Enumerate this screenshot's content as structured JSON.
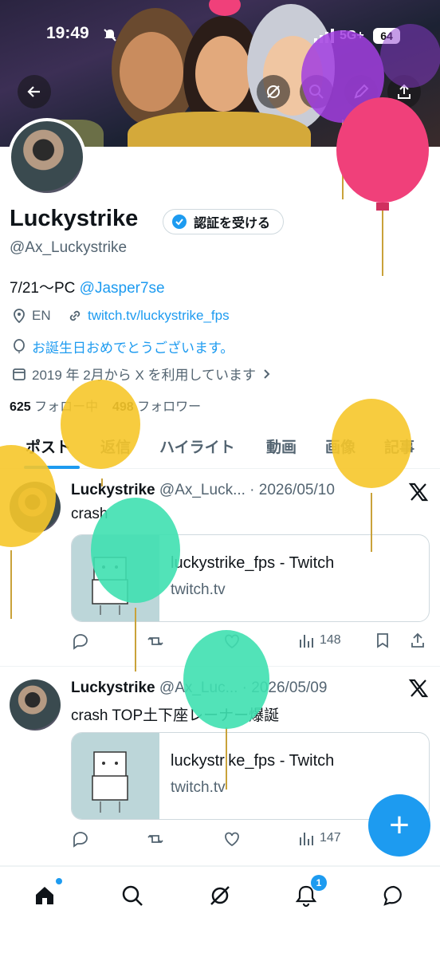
{
  "status_bar": {
    "time": "19:49",
    "network": "5G+",
    "battery": "64"
  },
  "profile": {
    "name": "Luckystrike",
    "verify_label": "認証を受ける",
    "handle": "@Ax_Luckystrike",
    "bio_text": "7/21〜PC ",
    "bio_mention": "@Jasper7se",
    "location": "EN",
    "website": "twitch.tv/luckystrike_fps",
    "birthday": "お誕生日おめでとうございます。",
    "joined": "2019 年 2月から X を利用しています",
    "following_count": "625",
    "following_label": "フォロー中",
    "followers_count": "498",
    "followers_label": "フォロワー"
  },
  "tabs": [
    "ポスト",
    "返信",
    "ハイライト",
    "動画",
    "画像",
    "記事"
  ],
  "posts": [
    {
      "author": "Luckystrike",
      "handle_date": "@Ax_Luck... · 2026/05/10",
      "text": "crash",
      "card_title": "luckystrike_fps - Twitch",
      "card_domain": "twitch.tv",
      "views": "148"
    },
    {
      "author": "Luckystrike",
      "handle_date": "@Ax_Luc... · 2026/05/09",
      "text": "crash TOP土下座レーナー爆誕",
      "card_title": "luckystrike_fps - Twitch",
      "card_domain": "twitch.tv",
      "views": "147"
    }
  ],
  "fab_label": "+",
  "notifications_badge": "1",
  "colors": {
    "accent": "#1d9bf0",
    "text": "#0f1419",
    "muted": "#536471"
  }
}
